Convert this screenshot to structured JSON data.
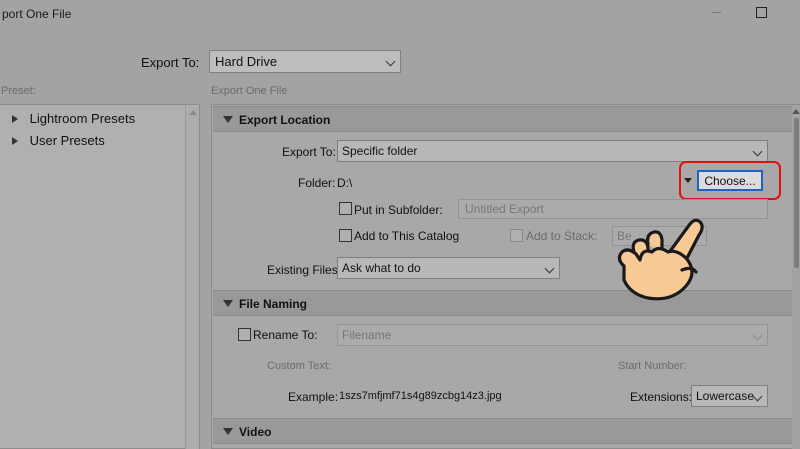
{
  "window": {
    "title": "port One File"
  },
  "header": {
    "export_to_label": "Export To:",
    "export_to_value": "Hard Drive"
  },
  "preset": {
    "label": "Preset:",
    "items": [
      {
        "label": "Lightroom Presets"
      },
      {
        "label": "User Presets"
      }
    ]
  },
  "settings": {
    "label": "Export One File",
    "export_location": {
      "title": "Export Location",
      "export_to_label": "Export To:",
      "export_to_value": "Specific folder",
      "folder_label": "Folder:",
      "folder_value": "D:\\",
      "choose_label": "Choose...",
      "subfolder_label": "Put in Subfolder:",
      "subfolder_placeholder": "Untitled Export",
      "catalog_label": "Add to This Catalog",
      "stack_label": "Add to Stack:",
      "stack_value": "Be",
      "existing_label": "Existing Files:",
      "existing_value": "Ask what to do"
    },
    "file_naming": {
      "title": "File Naming",
      "rename_label": "Rename To:",
      "rename_value": "Filename",
      "custom_text_label": "Custom Text:",
      "start_number_label": "Start Number:",
      "example_label": "Example:",
      "example_value": "1szs7mfjmf71s4g89zcbg14z3.jpg",
      "extensions_label": "Extensions:",
      "extensions_value": "Lowercase"
    },
    "video": {
      "title": "Video"
    }
  },
  "colors": {
    "highlight": "#e01010",
    "focus_border": "#1f62c7",
    "hand_fill": "#f7c995"
  },
  "icons": {
    "pointer": "pointing-hand-icon"
  }
}
